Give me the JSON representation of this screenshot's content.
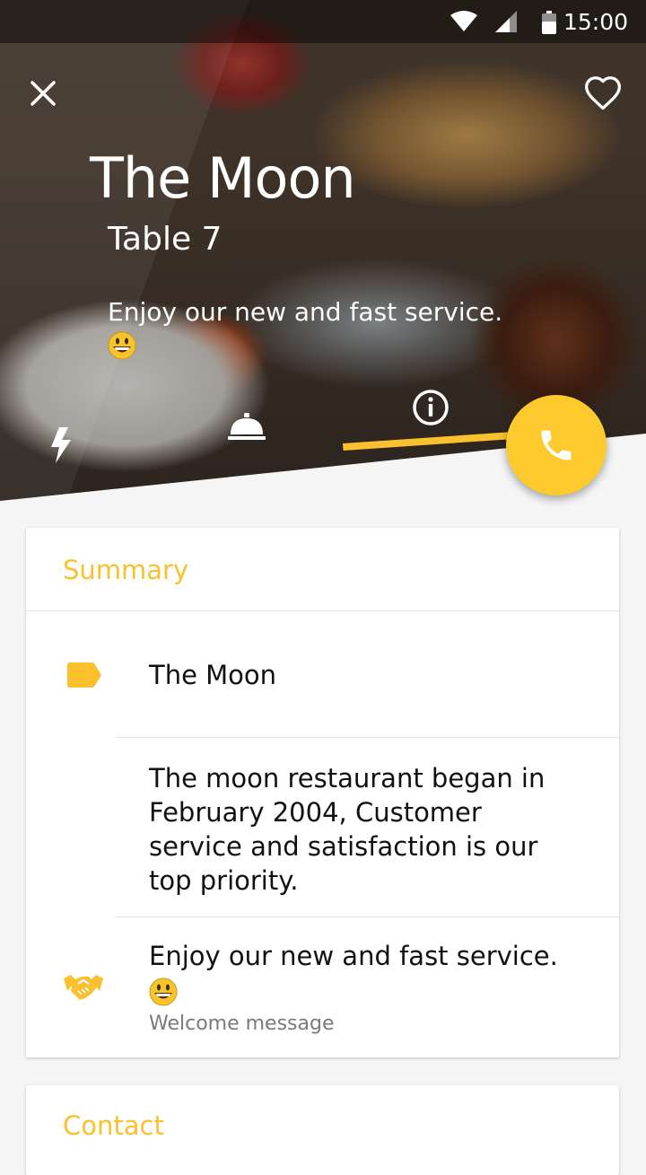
{
  "status_bar": {
    "time": "15:00"
  },
  "hero": {
    "title": "The Moon",
    "subtitle": "Table 7",
    "tagline": "Enjoy our new and fast service."
  },
  "tabs": [
    {
      "name": "flash-icon",
      "active": false
    },
    {
      "name": "room-service-icon",
      "active": false
    },
    {
      "name": "info-icon",
      "active": true
    }
  ],
  "colors": {
    "accent": "#fbc02d",
    "fab": "#fdca2e"
  },
  "summary": {
    "title": "Summary",
    "name": "The Moon",
    "description": "The moon restaurant began in February 2004, Customer service and satisfaction is our top priority.",
    "welcome_message": "Enjoy our new and fast service.",
    "welcome_caption": "Welcome message"
  },
  "contact": {
    "title": "Contact"
  }
}
